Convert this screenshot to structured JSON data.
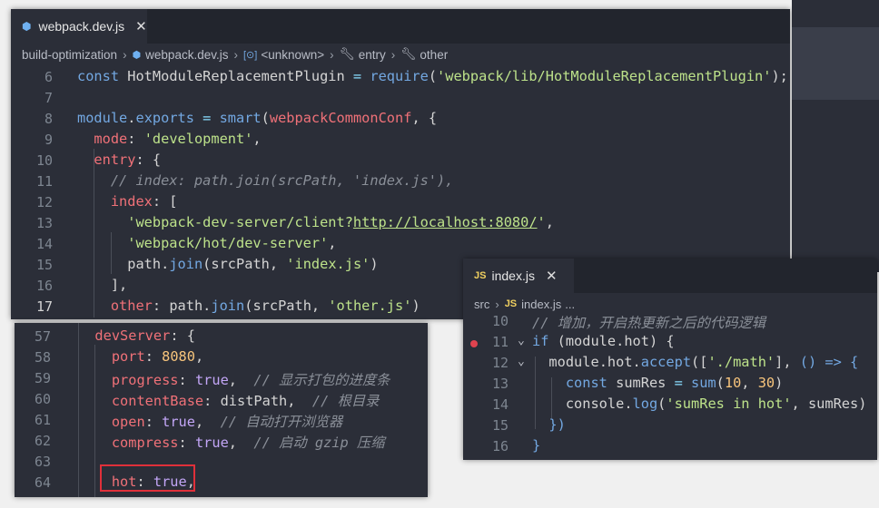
{
  "colors": {
    "bg": "#2b2e38",
    "tabbar": "#22252d",
    "keyword": "#73a8e2",
    "property": "#f07178",
    "string": "#bde28a",
    "number": "#f8c57c",
    "boolean": "#c3a6f7",
    "comment": "#8a8f98",
    "highlight_box": "#e0303a",
    "breakpoint": "#e0434f"
  },
  "main": {
    "tab_icon": "webpack-cube-icon",
    "tab_label": "webpack.dev.js",
    "breadcrumb": [
      "build-optimization",
      "webpack.dev.js",
      "<unknown>",
      "entry",
      "other"
    ],
    "lines": [
      {
        "n": "6",
        "tokens": [
          [
            "const ",
            "k"
          ],
          [
            "HotModuleReplacementPlugin",
            "t"
          ],
          [
            " = ",
            "o"
          ],
          [
            "require",
            "k"
          ],
          [
            "(",
            "t"
          ],
          [
            "'webpack/lib/HotModuleReplacementPlugin'",
            "s"
          ],
          [
            ");",
            "t"
          ]
        ]
      },
      {
        "n": "7",
        "tokens": []
      },
      {
        "n": "8",
        "tokens": [
          [
            "module",
            "k"
          ],
          [
            ".",
            "t"
          ],
          [
            "exports",
            "k"
          ],
          [
            " = ",
            "o"
          ],
          [
            "smart",
            "k"
          ],
          [
            "(",
            "t"
          ],
          [
            "webpackCommonConf",
            "p"
          ],
          [
            ", {",
            "t"
          ]
        ]
      },
      {
        "n": "9",
        "tokens": [
          [
            "  mode",
            "p"
          ],
          [
            ": ",
            "t"
          ],
          [
            "'development'",
            "s"
          ],
          [
            ",",
            "t"
          ]
        ]
      },
      {
        "n": "10",
        "tokens": [
          [
            "  entry",
            "p"
          ],
          [
            ": {",
            "t"
          ]
        ]
      },
      {
        "n": "11",
        "tokens": [
          [
            "    // index: path.join(srcPath, 'index.js'),",
            "c"
          ]
        ]
      },
      {
        "n": "12",
        "tokens": [
          [
            "    index",
            "p"
          ],
          [
            ": [",
            "t"
          ]
        ]
      },
      {
        "n": "13",
        "tokens": [
          [
            "      'webpack-dev-server/client?",
            "s"
          ],
          [
            "http://localhost:8080/",
            "su"
          ],
          [
            "'",
            "s"
          ],
          [
            ",",
            "t"
          ]
        ]
      },
      {
        "n": "14",
        "tokens": [
          [
            "      'webpack/hot/dev-server'",
            "s"
          ],
          [
            ",",
            "t"
          ]
        ]
      },
      {
        "n": "15",
        "tokens": [
          [
            "      path",
            "t"
          ],
          [
            ".",
            "t"
          ],
          [
            "join",
            "k"
          ],
          [
            "(",
            "t"
          ],
          [
            "srcPath",
            "t"
          ],
          [
            ", ",
            "t"
          ],
          [
            "'index.js'",
            "s"
          ],
          [
            ")",
            "t"
          ]
        ]
      },
      {
        "n": "16",
        "tokens": [
          [
            "    ],",
            "t"
          ]
        ]
      },
      {
        "n": "17",
        "tokens": [
          [
            "    other",
            "p"
          ],
          [
            ": ",
            "t"
          ],
          [
            "path",
            "t"
          ],
          [
            ".",
            "t"
          ],
          [
            "join",
            "k"
          ],
          [
            "(",
            "t"
          ],
          [
            "srcPath",
            "t"
          ],
          [
            ", ",
            "t"
          ],
          [
            "'other.js'",
            "s"
          ],
          [
            ")",
            "t"
          ]
        ]
      }
    ]
  },
  "devserver": {
    "lines": [
      {
        "n": "57",
        "tokens": [
          [
            "  devServer",
            "p"
          ],
          [
            ": {",
            "t"
          ]
        ]
      },
      {
        "n": "58",
        "tokens": [
          [
            "    port",
            "p"
          ],
          [
            ": ",
            "t"
          ],
          [
            "8080",
            "n"
          ],
          [
            ",",
            "t"
          ]
        ]
      },
      {
        "n": "59",
        "tokens": [
          [
            "    progress",
            "p"
          ],
          [
            ": ",
            "t"
          ],
          [
            "true",
            "b"
          ],
          [
            ",  ",
            "t"
          ],
          [
            "// 显示打包的进度条",
            "c"
          ]
        ]
      },
      {
        "n": "60",
        "tokens": [
          [
            "    contentBase",
            "p"
          ],
          [
            ": ",
            "t"
          ],
          [
            "distPath",
            "t"
          ],
          [
            ",  ",
            "t"
          ],
          [
            "// 根目录",
            "c"
          ]
        ]
      },
      {
        "n": "61",
        "tokens": [
          [
            "    open",
            "p"
          ],
          [
            ": ",
            "t"
          ],
          [
            "true",
            "b"
          ],
          [
            ",  ",
            "t"
          ],
          [
            "// 自动打开浏览器",
            "c"
          ]
        ]
      },
      {
        "n": "62",
        "tokens": [
          [
            "    compress",
            "p"
          ],
          [
            ": ",
            "t"
          ],
          [
            "true",
            "b"
          ],
          [
            ",  ",
            "t"
          ],
          [
            "// 启动 gzip 压缩",
            "c"
          ]
        ]
      },
      {
        "n": "63",
        "tokens": []
      },
      {
        "n": "64",
        "tokens": [
          [
            "    hot",
            "p"
          ],
          [
            ": ",
            "t"
          ],
          [
            "true",
            "b"
          ],
          [
            ",",
            "t"
          ]
        ]
      }
    ]
  },
  "index": {
    "tab_icon": "js-file-icon",
    "tab_icon_text": "JS",
    "tab_label": "index.js",
    "breadcrumb": [
      "src",
      "index.js",
      "..."
    ],
    "lines": [
      {
        "n": "10",
        "tokens": [
          [
            "// 增加，开启热更新之后的代码逻辑",
            "c"
          ]
        ]
      },
      {
        "n": "11",
        "tokens": [
          [
            "if",
            "k"
          ],
          [
            " (",
            "t"
          ],
          [
            "module",
            "t"
          ],
          [
            ".",
            "t"
          ],
          [
            "hot",
            "t"
          ],
          [
            ") {",
            "t"
          ]
        ]
      },
      {
        "n": "12",
        "tokens": [
          [
            "  module",
            "t"
          ],
          [
            ".",
            "t"
          ],
          [
            "hot",
            "t"
          ],
          [
            ".",
            "t"
          ],
          [
            "accept",
            "k"
          ],
          [
            "([",
            "t"
          ],
          [
            "'./math'",
            "s"
          ],
          [
            "], ",
            "t"
          ],
          [
            "() => {",
            "k"
          ]
        ]
      },
      {
        "n": "13",
        "tokens": [
          [
            "    const ",
            "k"
          ],
          [
            "sumRes",
            "t"
          ],
          [
            " = ",
            "o"
          ],
          [
            "sum",
            "k"
          ],
          [
            "(",
            "t"
          ],
          [
            "10",
            "n"
          ],
          [
            ", ",
            "t"
          ],
          [
            "30",
            "n"
          ],
          [
            ")",
            "t"
          ]
        ]
      },
      {
        "n": "14",
        "tokens": [
          [
            "    console",
            "t"
          ],
          [
            ".",
            "t"
          ],
          [
            "log",
            "k"
          ],
          [
            "(",
            "t"
          ],
          [
            "'sumRes in hot'",
            "s"
          ],
          [
            ", ",
            "t"
          ],
          [
            "sumRes",
            "t"
          ],
          [
            ")",
            "t"
          ]
        ]
      },
      {
        "n": "15",
        "tokens": [
          [
            "  })",
            "k"
          ]
        ]
      },
      {
        "n": "16",
        "tokens": [
          [
            "}",
            "k"
          ]
        ]
      }
    ]
  }
}
